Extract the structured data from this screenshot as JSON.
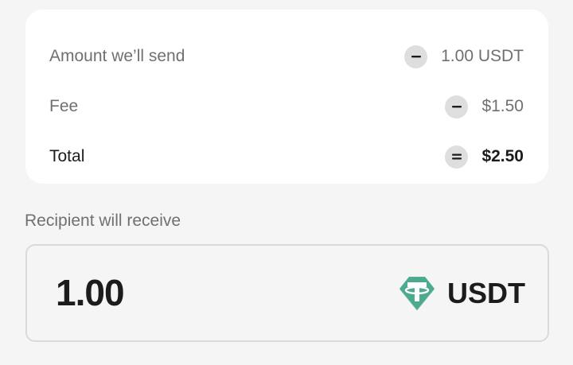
{
  "summary": {
    "amount": {
      "label": "Amount we’ll send",
      "operator": "minus",
      "value": "1.00 USDT"
    },
    "fee": {
      "label": "Fee",
      "operator": "minus",
      "value": "$1.50"
    },
    "total": {
      "label": "Total",
      "operator": "equals",
      "value": "$2.50"
    }
  },
  "recipient": {
    "label": "Recipient will receive",
    "amount": "1.00",
    "currency": "USDT",
    "currency_icon": "tether-icon"
  },
  "colors": {
    "background": "#f5f5f5",
    "card": "#ffffff",
    "badge": "#dedede",
    "text_primary": "#1c1c1c",
    "text_secondary": "#707070",
    "tether": "#50af95"
  }
}
